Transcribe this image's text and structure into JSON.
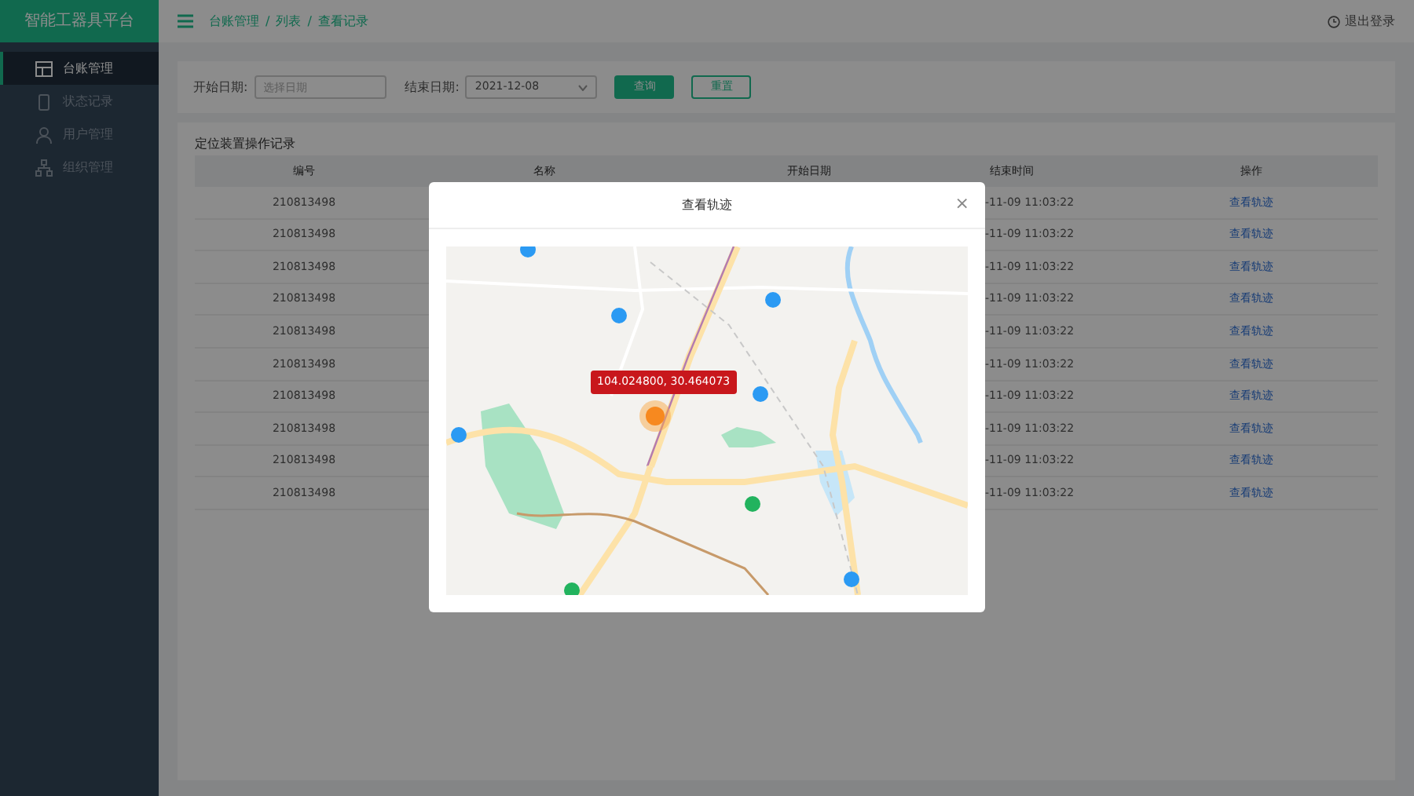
{
  "app_title": "智能工器具平台",
  "sidebar": {
    "items": [
      {
        "label": "台账管理",
        "selected": true
      },
      {
        "label": "状态记录",
        "selected": false
      },
      {
        "label": "用户管理",
        "selected": false
      },
      {
        "label": "组织管理",
        "selected": false
      }
    ]
  },
  "breadcrumb": [
    "台账管理",
    "列表",
    "查看记录"
  ],
  "breadcrumb_separator": "/",
  "logout": "退出登录",
  "filters": {
    "start_label": "开始日期:",
    "start_placeholder": "选择日期",
    "end_label": "结束日期:",
    "end_value": "2021-12-08",
    "query_button": "查询",
    "reset_button": "重置"
  },
  "table": {
    "title": "定位装置操作记录",
    "columns": [
      "编号",
      "名称",
      "开始日期",
      "结束时间",
      "操作"
    ],
    "rows": [
      {
        "id": "210813498",
        "end_time": "-11-09 11:03:22",
        "action": "查看轨迹"
      },
      {
        "id": "210813498",
        "end_time": "-11-09 11:03:22",
        "action": "查看轨迹"
      },
      {
        "id": "210813498",
        "end_time": "-11-09 11:03:22",
        "action": "查看轨迹"
      },
      {
        "id": "210813498",
        "end_time": "-11-09 11:03:22",
        "action": "查看轨迹"
      },
      {
        "id": "210813498",
        "end_time": "-11-09 11:03:22",
        "action": "查看轨迹"
      },
      {
        "id": "210813498",
        "end_time": "-11-09 11:03:22",
        "action": "查看轨迹"
      },
      {
        "id": "210813498",
        "end_time": "-11-09 11:03:22",
        "action": "查看轨迹"
      },
      {
        "id": "210813498",
        "end_time": "-11-09 11:03:22",
        "action": "查看轨迹"
      },
      {
        "id": "210813498",
        "end_time": "-11-09 11:03:22",
        "action": "查看轨迹"
      },
      {
        "id": "210813498",
        "end_time": "-11-09 11:03:22",
        "action": "查看轨迹"
      }
    ]
  },
  "modal": {
    "title": "查看轨迹",
    "close": "×",
    "coordinates": "104.024800, 30.464073"
  }
}
